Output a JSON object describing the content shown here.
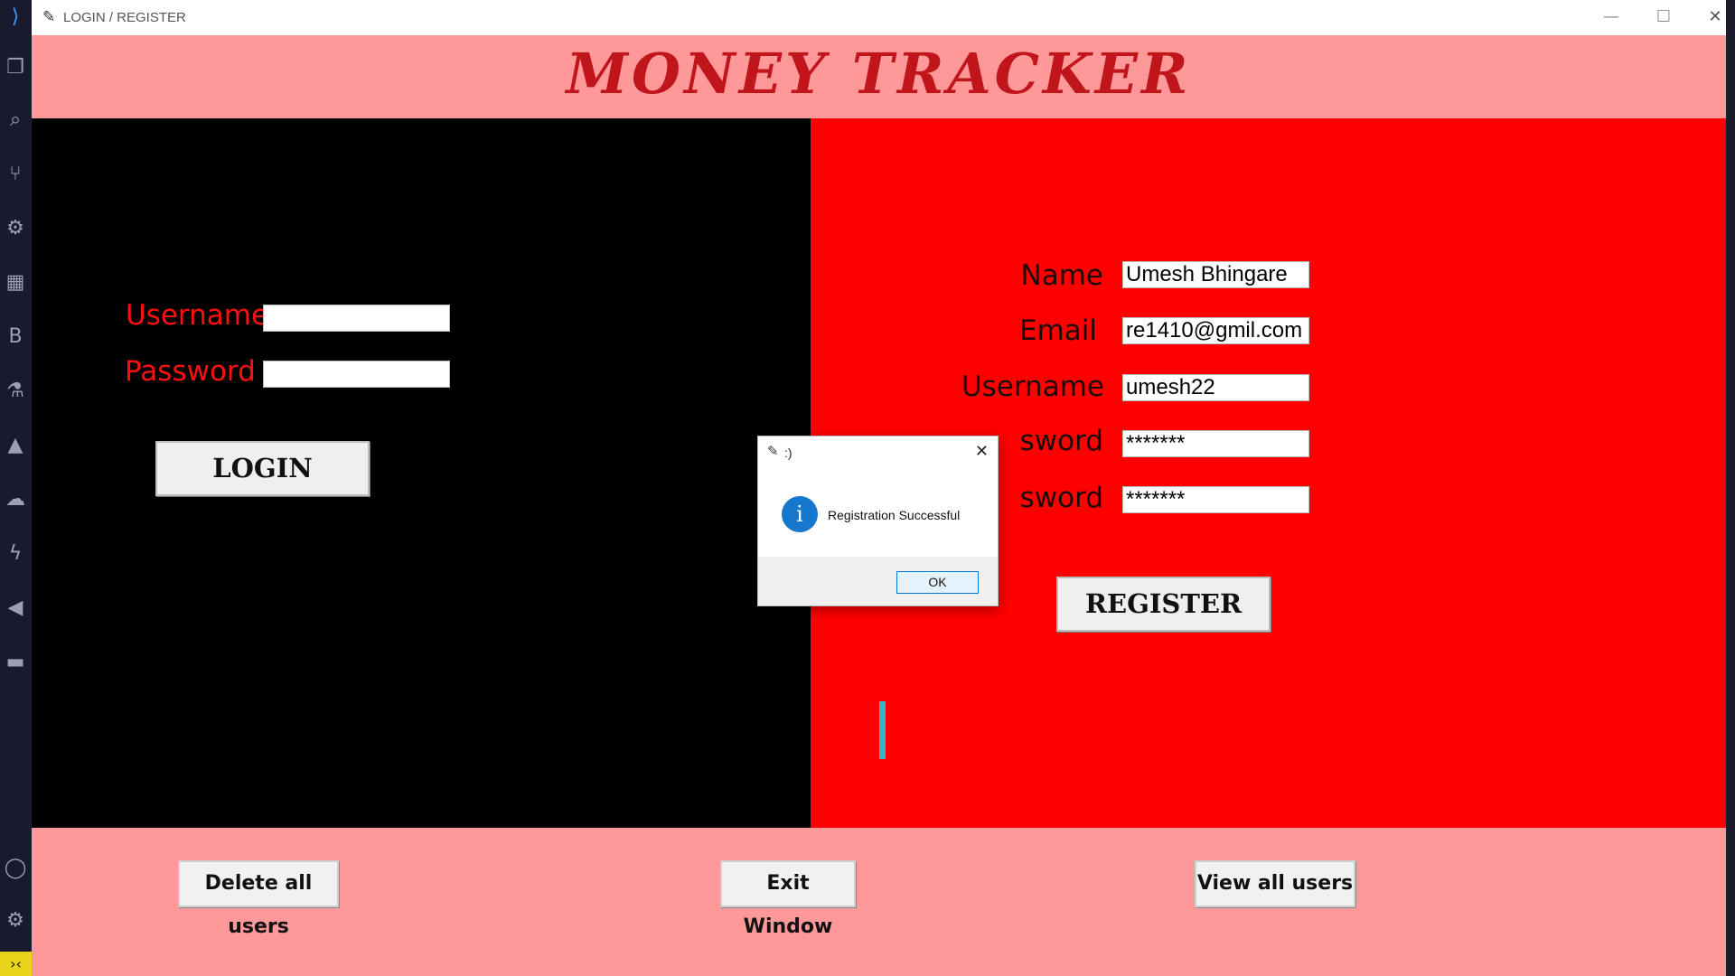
{
  "window": {
    "title": "LOGIN / REGISTER",
    "minimize": "—",
    "maximize": "☐",
    "close": "✕"
  },
  "header": {
    "app_title": "MONEY TRACKER"
  },
  "login": {
    "username_label": "Username",
    "password_label": "Password",
    "username_value": "",
    "password_value": "",
    "login_button": "LOGIN"
  },
  "register": {
    "name_label": "Name",
    "email_label": "Email",
    "username_label": "Username",
    "password_label": "sword",
    "confirm_label": "sword",
    "name_value": "Umesh Bhingare",
    "email_value": "re1410@gmil.com",
    "username_value": "umesh22",
    "password_value": "*******",
    "confirm_value": "*******",
    "register_button": "REGISTER"
  },
  "footer": {
    "delete_button": "Delete all users",
    "exit_button": "Exit Window",
    "view_button": "View all users"
  },
  "dialog": {
    "title": ":)",
    "message": "Registration Successful",
    "ok_button": "OK",
    "close": "✕"
  },
  "colors": {
    "header_bg": "#ff9999",
    "title_color": "#c0161b",
    "left_bg": "#000000",
    "right_bg": "#ff0000"
  }
}
